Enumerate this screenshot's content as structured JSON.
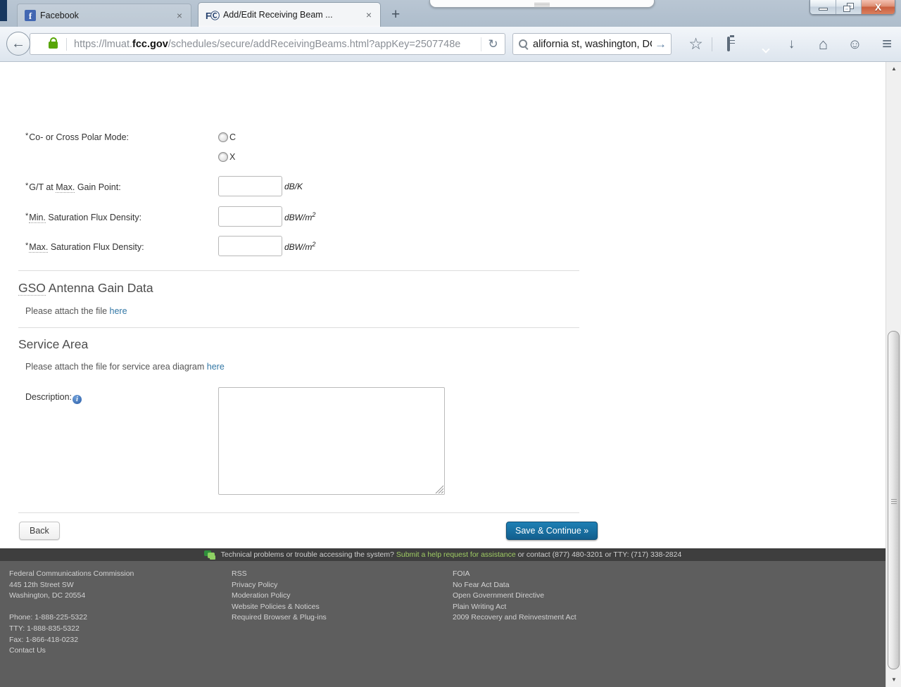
{
  "browser": {
    "tabs": [
      {
        "label": "Facebook",
        "close": "×"
      },
      {
        "label": "Add/Edit Receiving Beam ...",
        "close": "×"
      }
    ],
    "new_tab": "+",
    "back_glyph": "←",
    "reload_glyph": "↻",
    "url": {
      "prefix": "https://lmuat.",
      "domain": "fcc.gov",
      "path": "/schedules/secure/addReceivingBeams.html?appKey=2507748e"
    },
    "search": {
      "value": "alifornia st, washington, DC",
      "go_glyph": "→"
    },
    "toolbar_glyphs": {
      "star": "☆",
      "download": "↓",
      "home": "⌂",
      "smiley": "☺",
      "menu": "≡"
    },
    "window_glyphs": {
      "close": "X"
    },
    "fcc_favicon_text": "FⒸ",
    "fb_favicon_text": "f",
    "scroll_up": "▲",
    "scroll_down": "▼"
  },
  "form": {
    "polar": {
      "required_mark": "*",
      "label": "Co- or Cross Polar Mode:",
      "options": [
        "C",
        "X"
      ]
    },
    "gt": {
      "required_mark": "*",
      "before": "G/T at ",
      "abbr": "Max.",
      "after": " Gain Point:",
      "unit": "dB/K",
      "value": ""
    },
    "minsfd": {
      "required_mark": "*",
      "abbr": "Min.",
      "after": " Saturation Flux Density:",
      "unit_base": "dBW/m",
      "unit_sup": "2",
      "value": ""
    },
    "maxsfd": {
      "required_mark": "*",
      "abbr": "Max.",
      "after": " Saturation Flux Density:",
      "unit_base": "dBW/m",
      "unit_sup": "2",
      "value": ""
    }
  },
  "gso": {
    "heading_abbr": "GSO",
    "heading_rest": " Antenna Gain Data",
    "attach_text": "Please attach the file ",
    "attach_link": "here"
  },
  "service": {
    "heading": "Service Area",
    "attach_text": "Please attach the file for service area diagram ",
    "attach_link": "here"
  },
  "description": {
    "label": "Description:",
    "info_glyph": "i",
    "value": ""
  },
  "actions": {
    "back": "Back",
    "save": "Save & Continue »"
  },
  "helpbar": {
    "before": "Technical problems or trouble accessing the system? ",
    "link": "Submit a help request for assistance",
    "after": " or contact (877) 480-3201 or TTY: (717) 338-2824"
  },
  "footer": {
    "address": [
      "Federal Communications Commission",
      "445 12th Street SW",
      "Washington, DC 20554"
    ],
    "phones": [
      "Phone: 1-888-225-5322",
      "TTY: 1-888-835-5322",
      "Fax: 1-866-418-0232"
    ],
    "contact": "Contact Us",
    "col2": [
      "RSS",
      "Privacy Policy",
      "Moderation Policy",
      "Website Policies & Notices",
      "Required Browser & Plug-ins"
    ],
    "col3": [
      "FOIA",
      "No Fear Act Data",
      "Open Government Directive",
      "Plain Writing Act",
      "2009 Recovery and Reinvestment Act"
    ]
  },
  "colors": {
    "accent_blue_button": "#15689a",
    "link_blue": "#3277a5",
    "link_green": "#9fcc63",
    "helpbar_bg": "#3e3e3e",
    "footer_bg": "#5e5e5e",
    "lock_green": "#57a506",
    "tabbar_bg": "#b9c6d3"
  }
}
